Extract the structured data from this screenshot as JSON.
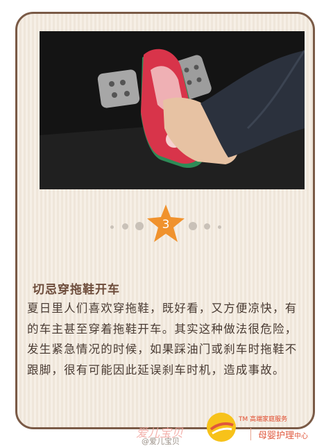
{
  "card": {
    "step_number": "3",
    "title": "切忌穿拖鞋开车",
    "body": "夏日里人们喜欢穿拖鞋，既好看，又方便凉快，有的车主甚至穿着拖鞋开车。其实这种做法很危险，发生紧急情况的时候，如果踩油门或刹车时拖鞋不跟脚，很有可能因此延误刹车时机，造成事故。"
  },
  "photo": {
    "subject": "driver wearing flip-flop slippers on car pedals"
  },
  "colors": {
    "accent_star": "#f0922d",
    "border": "#7a5a46",
    "title": "#6d4c3b",
    "logo_red": "#e0573c",
    "logo_yellow": "#f7c21a"
  },
  "footer": {
    "watermark": "爱儿宝贝",
    "source": "@爱儿宝贝",
    "logo_tm": "TM 高端家庭服务",
    "logo_name": "母婴护理",
    "logo_suffix": "中心"
  }
}
